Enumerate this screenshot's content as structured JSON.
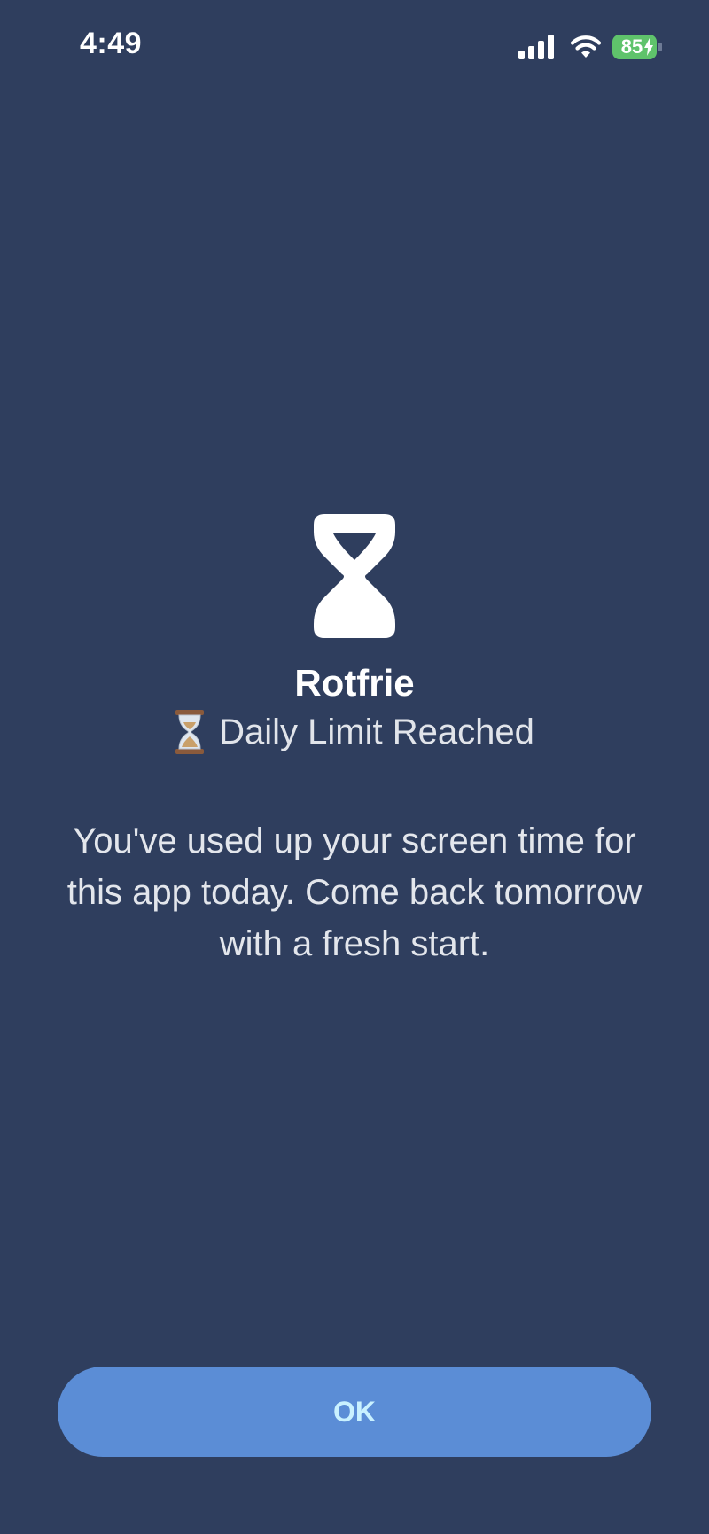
{
  "status_bar": {
    "time": "4:49",
    "battery_level": "85",
    "battery_color": "#5fc36b",
    "icons": [
      "signal-icon",
      "wifi-icon",
      "battery-icon",
      "charging-bolt-icon"
    ]
  },
  "screen": {
    "main_icon": "hourglass-icon",
    "app_name": "Rotfrie",
    "subtitle_emoji": "hourglass-emoji-icon",
    "subtitle": "Daily Limit Reached",
    "message": "You've used up your screen time for this app today. Come back tomorrow with a fresh start.",
    "background_color": "#2f3e5e"
  },
  "actions": {
    "ok_label": "OK",
    "ok_color": "#5b8dd6"
  }
}
